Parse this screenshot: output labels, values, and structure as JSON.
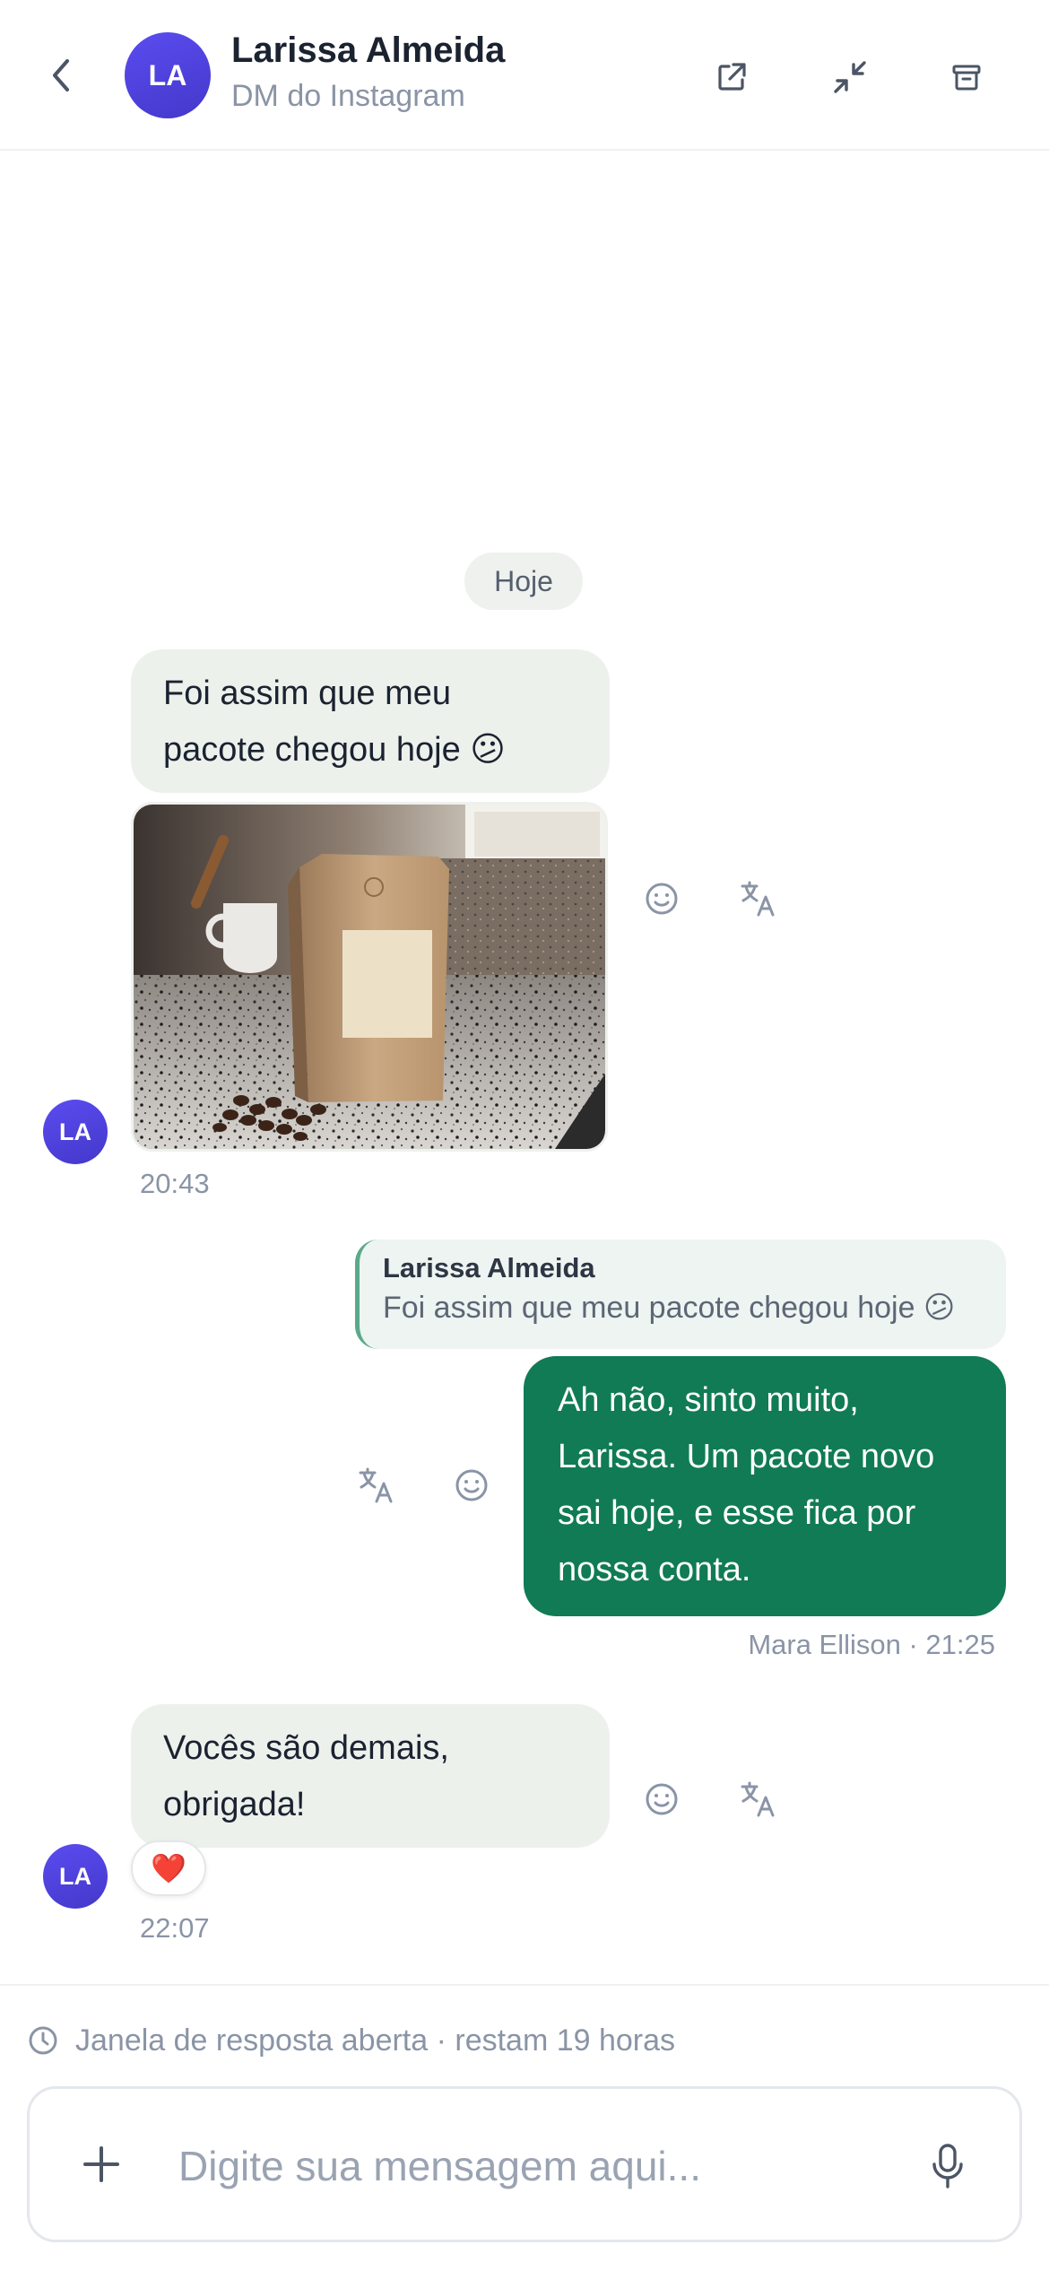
{
  "header": {
    "avatar_initials": "LA",
    "contact_name": "Larissa Almeida",
    "channel": "DM do Instagram",
    "icons": [
      "chevron-left-icon",
      "external-link-icon",
      "minimize-icon",
      "archive-icon"
    ]
  },
  "chat": {
    "day_separator": "Hoje",
    "messages": [
      {
        "direction": "incoming",
        "avatar_initials": "LA",
        "text_lines": [
          "Foi assim que meu",
          "pacote chegou hoje 😕"
        ],
        "image": "photo of a brown kraft coffee bag on a granite countertop with coffee beans",
        "time": "20:43"
      },
      {
        "direction": "outgoing",
        "reply_to": {
          "author": "Larissa Almeida",
          "text": "Foi assim que meu pacote chegou hoje 😕"
        },
        "text_lines": [
          "Ah não, sinto muito,",
          "Larissa. Um pacote novo",
          "sai hoje, e esse fica por",
          "nossa conta."
        ],
        "meta": "Mara Ellison · 21:25"
      },
      {
        "direction": "incoming",
        "avatar_initials": "LA",
        "text_lines": [
          "Vocês são demais,",
          "obrigada!"
        ],
        "reaction": "❤️",
        "time": "22:07"
      }
    ]
  },
  "footer": {
    "response_window": "Janela de resposta aberta · restam 19 horas",
    "input_placeholder": "Digite sua mensagem aqui...",
    "input_value": ""
  },
  "colors": {
    "accent": "#107b55",
    "incoming_bubble": "#edf1ec",
    "avatar": "#4f46e5",
    "muted_text": "#8a94a6"
  }
}
